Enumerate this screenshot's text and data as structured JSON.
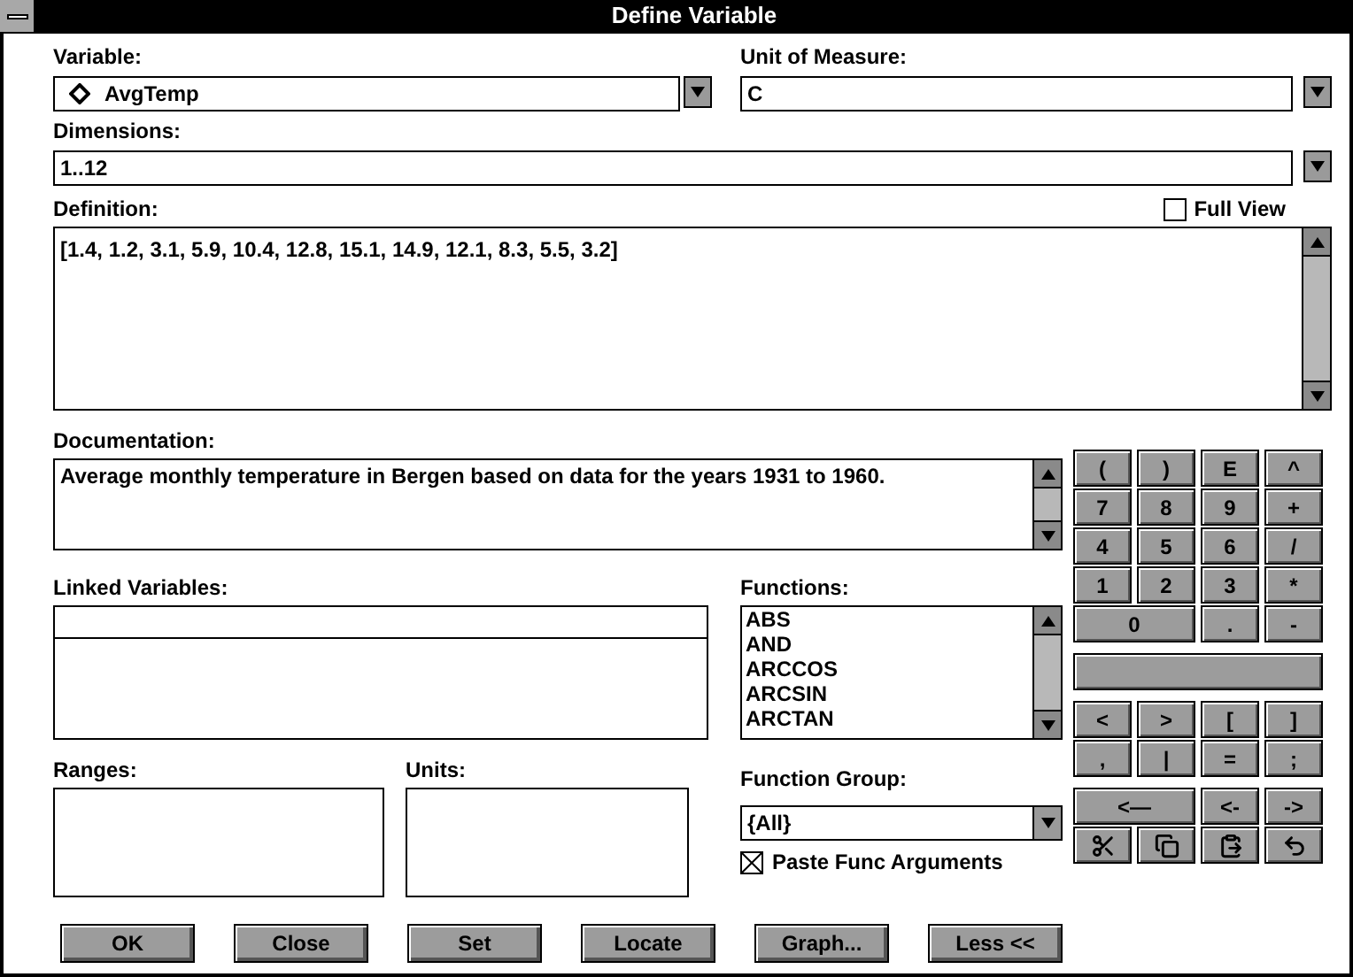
{
  "window": {
    "title": "Define Variable"
  },
  "variable": {
    "label": "Variable:",
    "value": "AvgTemp"
  },
  "unit_of_measure": {
    "label": "Unit of Measure:",
    "value": "C"
  },
  "dimensions": {
    "label": "Dimensions:",
    "value": "1..12"
  },
  "definition": {
    "label": "Definition:",
    "value": "[1.4, 1.2, 3.1, 5.9, 10.4, 12.8, 15.1, 14.9, 12.1, 8.3, 5.5, 3.2]"
  },
  "full_view": {
    "label": "Full View",
    "checked": false
  },
  "documentation": {
    "label": "Documentation:",
    "value": "Average monthly temperature in Bergen based on data for the years 1931 to 1960."
  },
  "linked_variables": {
    "label": "Linked Variables:"
  },
  "functions": {
    "label": "Functions:",
    "items": [
      "ABS",
      "AND",
      "ARCCOS",
      "ARCSIN",
      "ARCTAN"
    ]
  },
  "ranges": {
    "label": "Ranges:"
  },
  "units": {
    "label": "Units:"
  },
  "function_group": {
    "label": "Function Group:",
    "value": "{All}"
  },
  "paste_func_arguments": {
    "label": "Paste Func Arguments",
    "checked": true
  },
  "buttons": [
    "OK",
    "Close",
    "Set",
    "Locate",
    "Graph...",
    "Less <<"
  ],
  "keypad": [
    [
      [
        {
          "kind": "key",
          "label": "("
        },
        {
          "kind": "key",
          "label": ")"
        },
        {
          "kind": "key",
          "label": "E"
        },
        {
          "kind": "key",
          "label": "^"
        }
      ],
      [
        {
          "kind": "key",
          "label": "7"
        },
        {
          "kind": "key",
          "label": "8"
        },
        {
          "kind": "key",
          "label": "9"
        },
        {
          "kind": "key",
          "label": "+"
        }
      ],
      [
        {
          "kind": "key",
          "label": "4"
        },
        {
          "kind": "key",
          "label": "5"
        },
        {
          "kind": "key",
          "label": "6"
        },
        {
          "kind": "key",
          "label": "/"
        }
      ],
      [
        {
          "kind": "key",
          "label": "1"
        },
        {
          "kind": "key",
          "label": "2"
        },
        {
          "kind": "key",
          "label": "3"
        },
        {
          "kind": "key",
          "label": "*"
        }
      ],
      [
        {
          "kind": "wide",
          "label": "0"
        },
        {
          "kind": "key",
          "label": "."
        },
        {
          "kind": "key",
          "label": "-"
        }
      ]
    ],
    [
      [
        {
          "kind": "bar"
        }
      ]
    ],
    [
      [
        {
          "kind": "key",
          "label": "<"
        },
        {
          "kind": "key",
          "label": ">"
        },
        {
          "kind": "key",
          "label": "["
        },
        {
          "kind": "key",
          "label": "]"
        }
      ],
      [
        {
          "kind": "key",
          "label": ","
        },
        {
          "kind": "key",
          "label": "|"
        },
        {
          "kind": "key",
          "label": "="
        },
        {
          "kind": "key",
          "label": ";"
        }
      ]
    ],
    [
      [
        {
          "kind": "wide",
          "label": "<—"
        },
        {
          "kind": "key",
          "label": "<-"
        },
        {
          "kind": "key",
          "label": "->"
        }
      ],
      [
        {
          "kind": "cut"
        },
        {
          "kind": "copy"
        },
        {
          "kind": "paste"
        },
        {
          "kind": "undo"
        }
      ]
    ]
  ]
}
